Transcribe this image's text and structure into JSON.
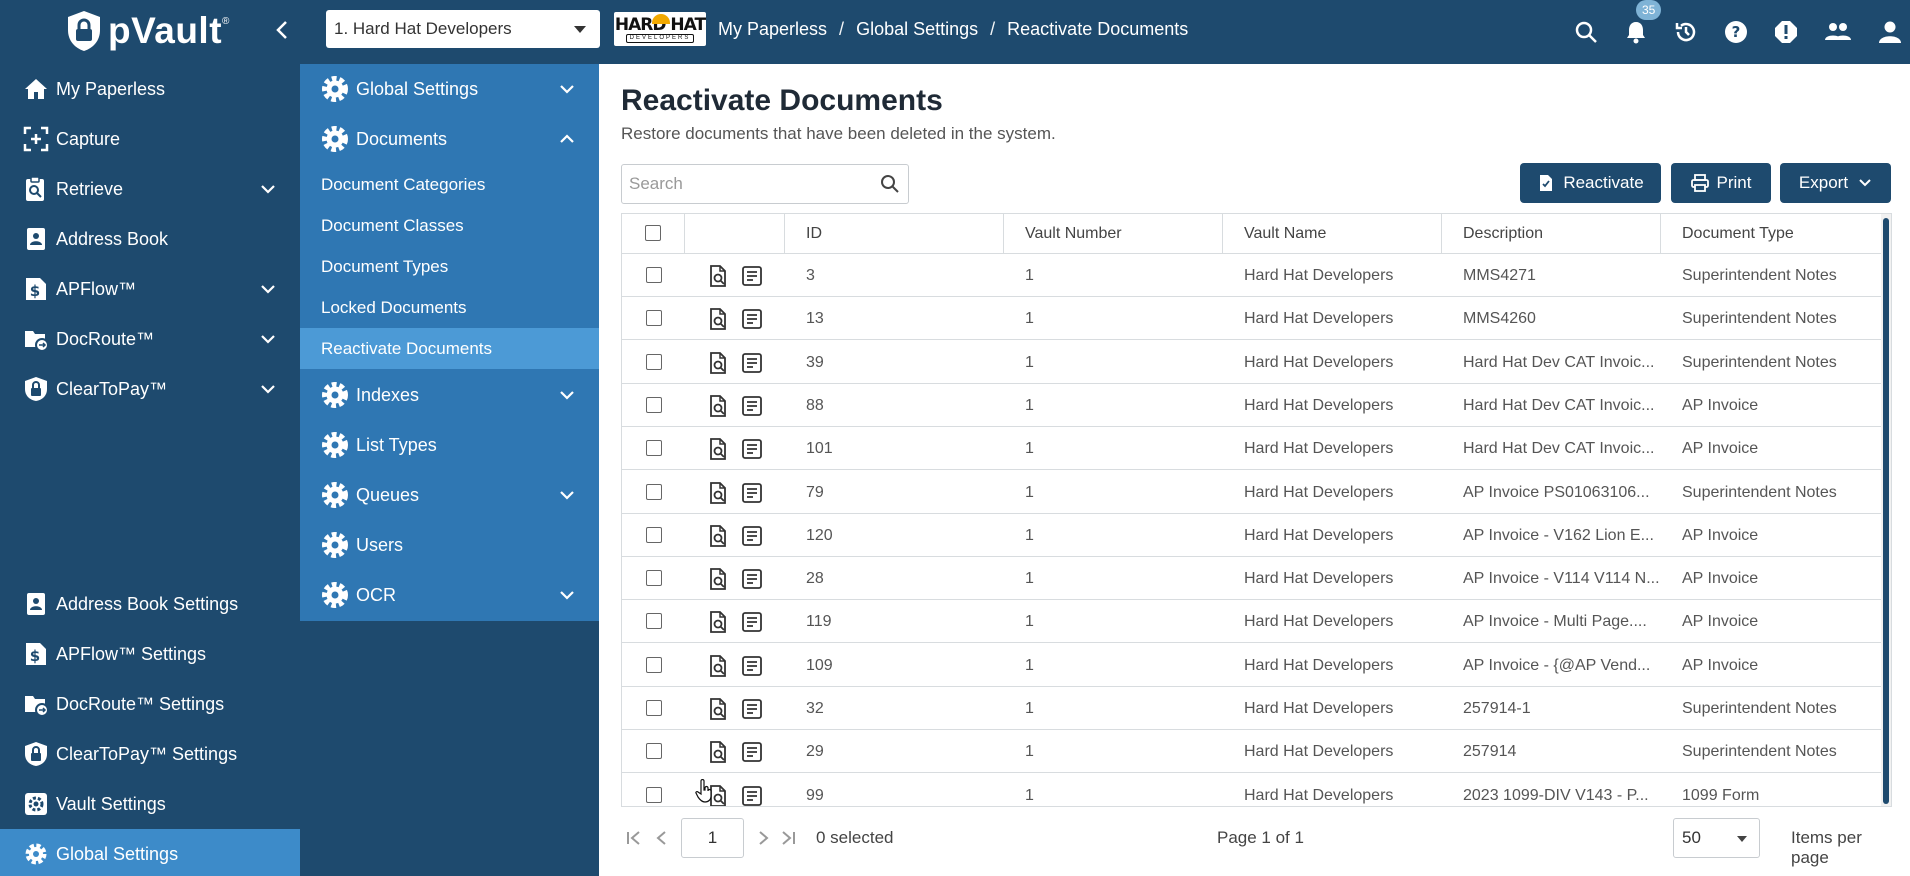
{
  "app": {
    "name": "pVault",
    "tm": "®"
  },
  "header": {
    "vault_select": "1. Hard Hat Developers",
    "client_logo_top": "HARD HAT",
    "client_logo_bottom": "DEVELOPERS",
    "breadcrumb": [
      "My Paperless",
      "Global Settings",
      "Reactivate Documents"
    ],
    "breadcrumb_sep": "/",
    "notifications_count": "35",
    "icons": [
      "search-icon",
      "bell-icon",
      "history-icon",
      "help-icon",
      "alert-icon",
      "users-icon",
      "profile-icon"
    ]
  },
  "sidebar": {
    "items": [
      {
        "label": "My Paperless",
        "icon": "home-icon",
        "expandable": false
      },
      {
        "label": "Capture",
        "icon": "capture-icon",
        "expandable": false
      },
      {
        "label": "Retrieve",
        "icon": "retrieve-icon",
        "expandable": true
      },
      {
        "label": "Address Book",
        "icon": "address-book-icon",
        "expandable": false
      },
      {
        "label": "APFlow™",
        "icon": "dollar-doc-icon",
        "expandable": true
      },
      {
        "label": "DocRoute™",
        "icon": "folder-route-icon",
        "expandable": true
      },
      {
        "label": "ClearToPay™",
        "icon": "lock-shield-icon",
        "expandable": true
      }
    ],
    "settings": [
      {
        "label": "Address Book Settings",
        "icon": "address-book-icon"
      },
      {
        "label": "APFlow™ Settings",
        "icon": "dollar-doc-icon"
      },
      {
        "label": "DocRoute™ Settings",
        "icon": "folder-route-icon"
      },
      {
        "label": "ClearToPay™ Settings",
        "icon": "lock-shield-icon"
      },
      {
        "label": "Vault Settings",
        "icon": "gear-box-icon"
      },
      {
        "label": "Global Settings",
        "icon": "gear-icon",
        "active": true
      }
    ]
  },
  "subnav": {
    "global_settings": "Global Settings",
    "documents": "Documents",
    "links": [
      "Document Categories",
      "Document Classes",
      "Document Types",
      "Locked Documents",
      "Reactivate Documents"
    ],
    "active_link": "Reactivate Documents",
    "indexes": "Indexes",
    "list_types": "List Types",
    "queues": "Queues",
    "users": "Users",
    "ocr": "OCR"
  },
  "main": {
    "title": "Reactivate Documents",
    "subtitle": "Restore documents that have been deleted in the system.",
    "search_placeholder": "Search",
    "buttons": {
      "reactivate": "Reactivate",
      "print": "Print",
      "export": "Export"
    },
    "columns": [
      "ID",
      "Vault Number",
      "Vault Name",
      "Description",
      "Document Type"
    ],
    "rows": [
      {
        "id": "3",
        "vault_number": "1",
        "vault_name": "Hard Hat Developers",
        "description": "MMS4271",
        "doc_type": "Superintendent Notes"
      },
      {
        "id": "13",
        "vault_number": "1",
        "vault_name": "Hard Hat Developers",
        "description": "MMS4260",
        "doc_type": "Superintendent Notes"
      },
      {
        "id": "39",
        "vault_number": "1",
        "vault_name": "Hard Hat Developers",
        "description": "Hard Hat Dev CAT Invoic...",
        "doc_type": "Superintendent Notes"
      },
      {
        "id": "88",
        "vault_number": "1",
        "vault_name": "Hard Hat Developers",
        "description": "Hard Hat Dev CAT Invoic...",
        "doc_type": "AP Invoice"
      },
      {
        "id": "101",
        "vault_number": "1",
        "vault_name": "Hard Hat Developers",
        "description": "Hard Hat Dev CAT Invoic...",
        "doc_type": "AP Invoice"
      },
      {
        "id": "79",
        "vault_number": "1",
        "vault_name": "Hard Hat Developers",
        "description": "AP Invoice PS01063106...",
        "doc_type": "Superintendent Notes"
      },
      {
        "id": "120",
        "vault_number": "1",
        "vault_name": "Hard Hat Developers",
        "description": "AP Invoice - V162 Lion E...",
        "doc_type": "AP Invoice"
      },
      {
        "id": "28",
        "vault_number": "1",
        "vault_name": "Hard Hat Developers",
        "description": "AP Invoice - V114 V114 N...",
        "doc_type": "AP Invoice"
      },
      {
        "id": "119",
        "vault_number": "1",
        "vault_name": "Hard Hat Developers",
        "description": "AP Invoice - Multi Page....",
        "doc_type": "AP Invoice"
      },
      {
        "id": "109",
        "vault_number": "1",
        "vault_name": "Hard Hat Developers",
        "description": "AP Invoice - {@AP Vend...",
        "doc_type": "AP Invoice"
      },
      {
        "id": "32",
        "vault_number": "1",
        "vault_name": "Hard Hat Developers",
        "description": "257914-1",
        "doc_type": "Superintendent Notes"
      },
      {
        "id": "29",
        "vault_number": "1",
        "vault_name": "Hard Hat Developers",
        "description": "257914",
        "doc_type": "Superintendent Notes"
      },
      {
        "id": "99",
        "vault_number": "1",
        "vault_name": "Hard Hat Developers",
        "description": "2023 1099-DIV V143 - P...",
        "doc_type": "1099 Form"
      }
    ],
    "pager": {
      "page_input": "1",
      "selected": "0 selected",
      "page_info": "Page 1 of 1",
      "per_page": "50",
      "per_page_label": "Items per page"
    }
  },
  "colors": {
    "nav_dark": "#1e4a6e",
    "nav_mid": "#2f77b3",
    "nav_active": "#4c9ad6",
    "sidebar_active": "#3d8bc9"
  }
}
